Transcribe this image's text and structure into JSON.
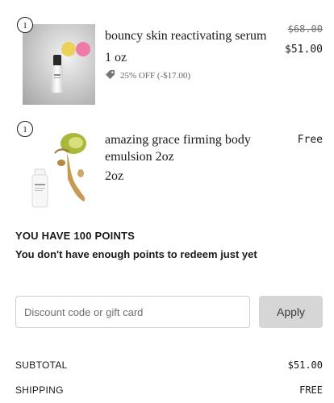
{
  "items": [
    {
      "quantity": "1",
      "name": "bouncy skin reactivating serum",
      "variant": "1 oz",
      "discount_text": "25% OFF (-$17.00)",
      "price_original": "$68.00",
      "price_final": "$51.00",
      "icons": [
        "tag-icon"
      ]
    },
    {
      "quantity": "1",
      "name": "amazing grace firming body emulsion 2oz",
      "variant": "2oz",
      "price_final": "Free"
    }
  ],
  "points": {
    "title": "YOU HAVE 100 POINTS",
    "message": "You don't have enough points to redeem just yet"
  },
  "discount": {
    "placeholder": "Discount code or gift card",
    "value": "",
    "apply_label": "Apply"
  },
  "summary": {
    "subtotal_label": "SUBTOTAL",
    "subtotal_value": "$51.00",
    "shipping_label": "SHIPPING",
    "shipping_value": "FREE"
  },
  "colors": {
    "text": "#1a1a1a",
    "muted": "#777777",
    "apply_bg": "#d6d6d6",
    "input_border": "#cfcfcf"
  }
}
